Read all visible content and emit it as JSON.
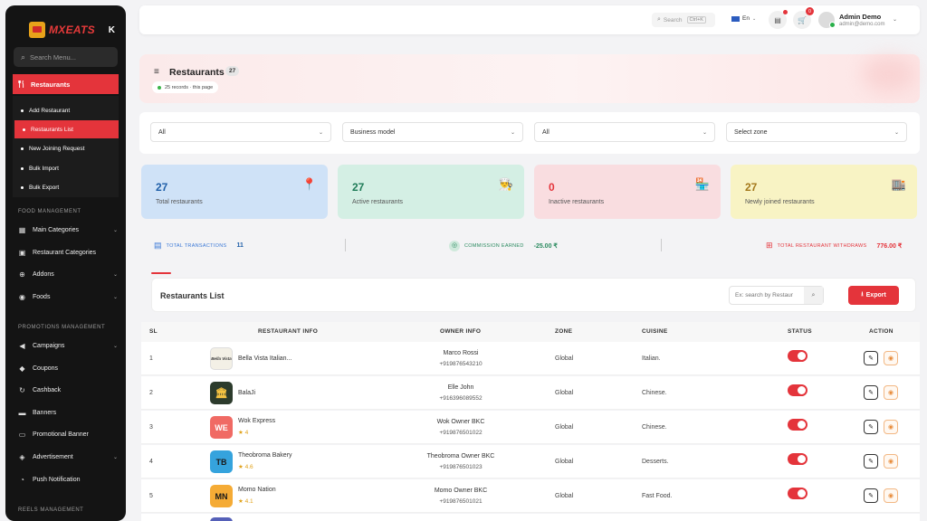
{
  "sidebar": {
    "brand": "MXEATS",
    "collapse": "K",
    "search_placeholder": "Search Menu...",
    "active_group": "Restaurants",
    "sub_items": [
      {
        "label": "Add Restaurant"
      },
      {
        "label": "Restaurants List"
      },
      {
        "label": "New Joining Request"
      },
      {
        "label": "Bulk Import"
      },
      {
        "label": "Bulk Export"
      }
    ],
    "section_food": "FOOD MANAGEMENT",
    "food_items": [
      {
        "label": "Main Categories",
        "icon": "grid-icon",
        "glyph": "▦",
        "chevron": true
      },
      {
        "label": "Restaurant Categories",
        "icon": "store-icon",
        "glyph": "▣",
        "chevron": false
      },
      {
        "label": "Addons",
        "icon": "plus-circle-icon",
        "glyph": "⊕",
        "chevron": true
      },
      {
        "label": "Foods",
        "icon": "food-icon",
        "glyph": "◉",
        "chevron": true
      }
    ],
    "section_promotions": "PROMOTIONS MANAGEMENT",
    "promo_items": [
      {
        "label": "Campaigns",
        "icon": "megaphone-icon",
        "glyph": "◀",
        "chevron": true
      },
      {
        "label": "Coupons",
        "icon": "tag-icon",
        "glyph": "◆",
        "chevron": false
      },
      {
        "label": "Cashback",
        "icon": "refresh-icon",
        "glyph": "↻",
        "chevron": false
      },
      {
        "label": "Banners",
        "icon": "banner-icon",
        "glyph": "▬",
        "chevron": false
      },
      {
        "label": "Promotional Banner",
        "icon": "image-icon",
        "glyph": "▭",
        "chevron": false
      },
      {
        "label": "Advertisement",
        "icon": "ad-icon",
        "glyph": "◈",
        "chevron": true
      },
      {
        "label": "Push Notification",
        "icon": "bell-icon",
        "glyph": "◔",
        "chevron": false
      }
    ],
    "section_reels": "REELS MANAGEMENT"
  },
  "header": {
    "search_placeholder": "Search",
    "search_shortcut": "Ctrl+K",
    "language": "En",
    "cart_count": "0",
    "user_name": "Admin Demo",
    "user_email": "admin@demo.com"
  },
  "page": {
    "title": "Restaurants",
    "count": "27",
    "records_text": "25 records · this page"
  },
  "filters": [
    {
      "value": "All"
    },
    {
      "value": "Business model"
    },
    {
      "value": "All"
    },
    {
      "value": "Select zone"
    }
  ],
  "stats": [
    {
      "value": "27",
      "label": "Total restaurants",
      "icon": "location-pin-icon",
      "bg": "#cfe2f7",
      "color": "#1f5fa8",
      "glyph": "📍"
    },
    {
      "value": "27",
      "label": "Active restaurants",
      "icon": "chef-icon",
      "bg": "#d4efe4",
      "color": "#1e7b57",
      "glyph": "👨‍🍳"
    },
    {
      "value": "0",
      "label": "Inactive restaurants",
      "icon": "closed-store-icon",
      "bg": "#f9dde0",
      "color": "#e4343b",
      "glyph": "🏪"
    },
    {
      "value": "27",
      "label": "Newly joined restaurants",
      "icon": "new-store-icon",
      "bg": "#f8f3c4",
      "color": "#a3771a",
      "glyph": "🏬"
    }
  ],
  "transactions": {
    "total_label": "TOTAL TRANSACTIONS",
    "total_value": "11",
    "commission_label": "COMMISSION EARNED",
    "commission_value": "-25.00 ₹",
    "withdraws_label": "TOTAL RESTAURANT WITHDRAWS",
    "withdraws_value": "776.00 ₹"
  },
  "list": {
    "title": "Restaurants List",
    "search_placeholder": "Ex: search by Restaur",
    "export_label": "Export",
    "columns": [
      "SL",
      "RESTAURANT INFO",
      "OWNER INFO",
      "ZONE",
      "CUISINE",
      "STATUS",
      "ACTION"
    ],
    "rows": [
      {
        "sl": "1",
        "name": "Bella Vista Italian...",
        "rating": "",
        "thumb_text": "Bella Vista",
        "thumb_bg": "#f3f0e6",
        "thumb_color": "#3a3a3a",
        "owner": "Marco Rossi",
        "phone": "+919876543210",
        "zone": "Global",
        "cuisine": "Italian.",
        "status": true
      },
      {
        "sl": "2",
        "name": "BalaJi",
        "rating": "",
        "thumb_text": "🏛",
        "thumb_bg": "#2c3b2c",
        "thumb_color": "#f5c342",
        "owner": "Elle John",
        "phone": "+916396089552",
        "zone": "Global",
        "cuisine": "Chinese.",
        "status": true
      },
      {
        "sl": "3",
        "name": "Wok Express",
        "rating": "★ 4",
        "thumb_text": "WE",
        "thumb_bg": "#f06a64",
        "thumb_color": "#ffffff",
        "owner": "Wok Owner BKC",
        "phone": "+919876501022",
        "zone": "Global",
        "cuisine": "Chinese.",
        "status": true
      },
      {
        "sl": "4",
        "name": "Theobroma Bakery",
        "rating": "★ 4.6",
        "thumb_text": "TB",
        "thumb_bg": "#35a3dd",
        "thumb_color": "#1a1a1a",
        "owner": "Theobroma Owner BKC",
        "phone": "+919876501023",
        "zone": "Global",
        "cuisine": "Desserts.",
        "status": true
      },
      {
        "sl": "5",
        "name": "Momo Nation",
        "rating": "★ 4.1",
        "thumb_text": "MN",
        "thumb_bg": "#f5ab35",
        "thumb_color": "#1a1a1a",
        "owner": "Momo Owner BKC",
        "phone": "+919876501021",
        "zone": "Global",
        "cuisine": "Fast Food.",
        "status": true
      }
    ]
  },
  "colors": {
    "accent": "#e4343b",
    "sidebar": "#141414"
  }
}
